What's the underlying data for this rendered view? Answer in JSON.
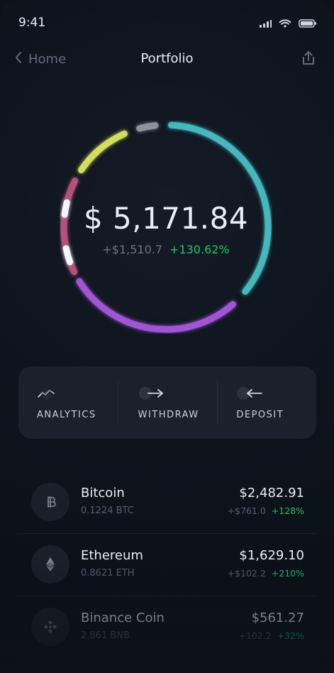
{
  "status": {
    "time": "9:41"
  },
  "header": {
    "back_label": "Home",
    "title": "Portfolio"
  },
  "summary": {
    "balance": "$ 5,171.84",
    "change_abs": "+$1,510.7",
    "change_pct": "+130.62%",
    "ring_colors": {
      "gray": "#8d939c",
      "teal": "#44b7bf",
      "purple": "#a155d6",
      "pink": "#b3537a",
      "yellow": "#d3df5a",
      "white": "#f4f6fb"
    }
  },
  "actions": {
    "analytics_label": "ANALYTICS",
    "withdraw_label": "WITHDRAW",
    "deposit_label": "DEPOSIT"
  },
  "assets": [
    {
      "name": "Bitcoin",
      "qty": "0.1224 BTC",
      "price": "$2,482.91",
      "change_abs": "+$761.0",
      "change_pct": "+128%",
      "icon": "bitcoin-icon"
    },
    {
      "name": "Ethereum",
      "qty": "0.8621 ETH",
      "price": "$1,629.10",
      "change_abs": "+$102.2",
      "change_pct": "+210%",
      "icon": "ethereum-icon"
    },
    {
      "name": "Binance Coin",
      "qty": "2.861 BNB",
      "price": "$561.27",
      "change_abs": "+102.2",
      "change_pct": "+32%",
      "icon": "binance-icon"
    }
  ]
}
